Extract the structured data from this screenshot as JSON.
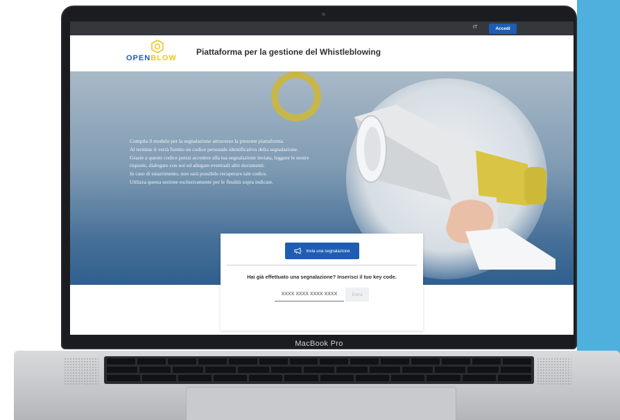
{
  "device": {
    "label": "MacBook Pro"
  },
  "topbar": {
    "language": "IT",
    "login_label": "Accedi"
  },
  "header": {
    "logo_text_part1": "OPEN",
    "logo_text_part2": "BLOW",
    "title": "Piattaforma per la gestione del Whistleblowing"
  },
  "hero": {
    "lines": [
      "Compila il modulo per la segnalazione attraverso la presente piattaforma.",
      "Al termine ti verrà fornito un codice personale identificativo della segnalazione.",
      "Grazie a questo codice potrai accedere alla tua segnalazione inviata, leggere le nostre",
      "risposte, dialogare con noi ed allegare eventuali altri documenti.",
      "In caso di smarrimento, non sarà possibile recuperare tale codice.",
      "Utilizza questa sezione esclusivamente per le finalità sopra indicate."
    ]
  },
  "card": {
    "report_button": "Invia una segnalazione",
    "question": "Hai già effettuato una segnalazione? Inserisci il tuo key code.",
    "code_placeholder": "XXXX XXXX XXXX XXXX",
    "enter_button": "Entra"
  },
  "colors": {
    "brand_blue": "#1f5db3",
    "brand_yellow": "#f0c419",
    "topbar": "#34373c",
    "accent_right": "#4fb0dd"
  },
  "icons": {
    "logo": "hexagon-logo-icon",
    "megaphone": "megaphone-icon"
  }
}
